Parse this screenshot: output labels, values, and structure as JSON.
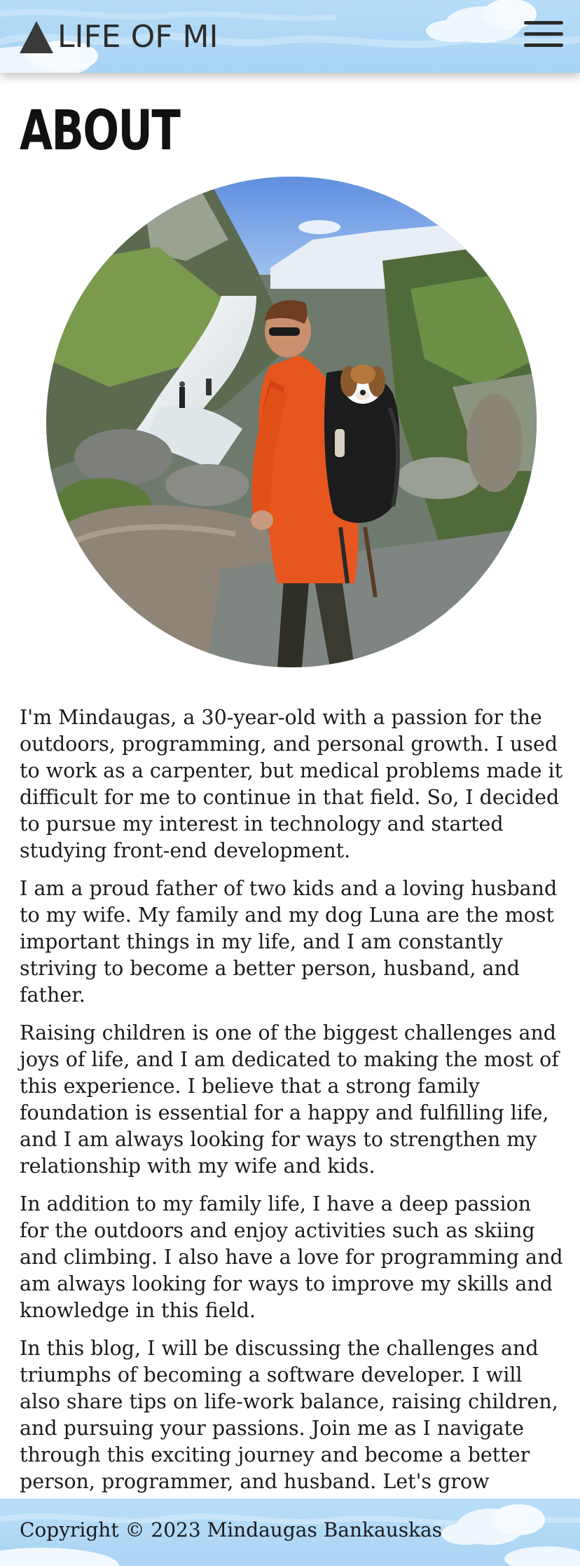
{
  "header": {
    "site_title": "LIFE OF MI",
    "logo_icon": "mountain-icon",
    "menu_icon": "hamburger-menu-icon"
  },
  "main": {
    "page_title": "ABOUT",
    "photo_icon": "profile-photo",
    "paragraphs": [
      "I'm Mindaugas, a 30-year-old with a passion for the outdoors, programming, and personal growth. I used to work as a carpenter, but medical problems made it difficult for me to continue in that field. So, I decided to pursue my interest in technology and started studying front-end development.",
      "I am a proud father of two kids and a loving husband to my wife. My family and my dog Luna are the most important things in my life, and I am constantly striving to become a better person, husband, and father.",
      "Raising children is one of the biggest challenges and joys of life, and I am dedicated to making the most of this experience. I believe that a strong family foundation is essential for a happy and fulfilling life, and I am always looking for ways to strengthen my relationship with my wife and kids.",
      "In addition to my family life, I have a deep passion for the outdoors and enjoy activities such as skiing and climbing. I also have a love for programming and am always looking for ways to improve my skills and knowledge in this field.",
      "In this blog, I will be discussing the challenges and triumphs of becoming a software developer. I will also share tips on life-work balance, raising children, and pursuing your passions. Join me as I navigate through this exciting journey and become a better person, programmer, and husband. Let's grow together!\""
    ]
  },
  "footer": {
    "copyright": "Copyright © 2023 Mindaugas Bankauskas"
  },
  "colors": {
    "sky": "#a9d4f4",
    "cloud": "#ffffff",
    "text": "#1b1b1b"
  }
}
